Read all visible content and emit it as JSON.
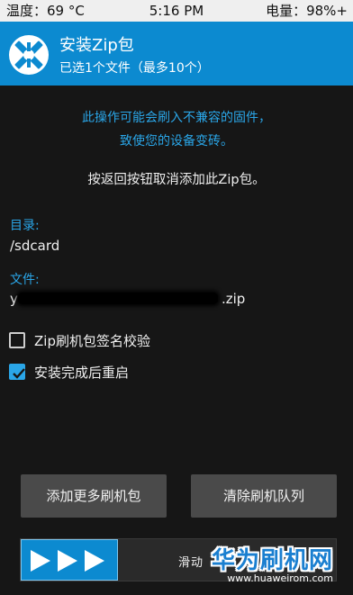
{
  "status_bar": {
    "temperature": "温度：69 °C",
    "time": "5:16 PM",
    "battery": "电量：98%+"
  },
  "header": {
    "logo_icon": "twrp-logo-icon",
    "title": "安装Zip包",
    "subtitle": "已选1个文件（最多10个）"
  },
  "warning": {
    "line1": "此操作可能会刷入不兼容的固件，",
    "line2": "致使您的设备变砖。"
  },
  "instruction": "按返回按钮取消添加此Zip包。",
  "directory": {
    "label": "目录:",
    "value": "/sdcard"
  },
  "file": {
    "label": "文件:",
    "value_prefix": "y",
    "value_suffix": ".zip"
  },
  "options": [
    {
      "label": "Zip刷机包签名校验",
      "checked": false
    },
    {
      "label": "安装完成后重启",
      "checked": true
    }
  ],
  "buttons": {
    "add_more": "添加更多刷机包",
    "clear_queue": "清除刷机队列"
  },
  "swipe": {
    "text": "滑动",
    "icon": "triple-arrow-icon"
  },
  "watermark": {
    "name": "华为刷机网",
    "url": "www.huaweirom.com"
  },
  "colors": {
    "accent": "#0c8ad0",
    "link_text": "#2aa6e8",
    "background": "#161616",
    "button": "#4a4a4a"
  }
}
